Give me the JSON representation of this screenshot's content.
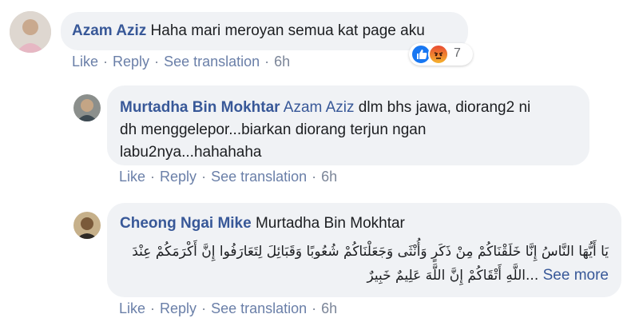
{
  "comments": [
    {
      "author": "Azam Aziz",
      "text": "Haha mari meroyan semua kat page aku",
      "actions": {
        "like": "Like",
        "reply": "Reply",
        "translate": "See translation",
        "time": "6h"
      },
      "reactions": {
        "count": "7",
        "icons": [
          "like-icon",
          "angry-icon"
        ],
        "colors": {
          "like": "#1877f2",
          "angry": "#f26a2b"
        }
      }
    },
    {
      "author": "Murtadha Bin Mokhtar",
      "mention": "Azam Aziz",
      "text_line1": "dlm bhs jawa, diorang2 ni",
      "text_line2": "dh menggelepor...biarkan diorang terjun ngan",
      "text_line3": "labu2nya...hahahaha",
      "actions": {
        "like": "Like",
        "reply": "Reply",
        "translate": "See translation",
        "time": "6h"
      }
    },
    {
      "author": "Cheong Ngai Mike",
      "mention": "Murtadha Bin Mokhtar",
      "arabic_line1": "يَا أَيُّهَا النَّاسُ إِنَّا خَلَقْنَاكُمْ مِنْ ذَكَرٍ وَأُنْثَى وَجَعَلْنَاكُمْ شُعُوبًا وَقَبَائِلَ لِتَعَارَفُوا إِنَّ أَكْرَمَكُمْ عِنْدَ",
      "arabic_line2": "...اللَّهِ أَتْقَاكُمْ إِنَّ اللَّهَ عَلِيمٌ خَبِيرٌ",
      "see_more": "See more",
      "actions": {
        "like": "Like",
        "reply": "Reply",
        "translate": "See translation",
        "time": "6h"
      }
    }
  ],
  "theme": {
    "link": "#385898",
    "bubble": "#f0f2f5",
    "text": "#1c1e21",
    "meta": "#7b8598"
  }
}
